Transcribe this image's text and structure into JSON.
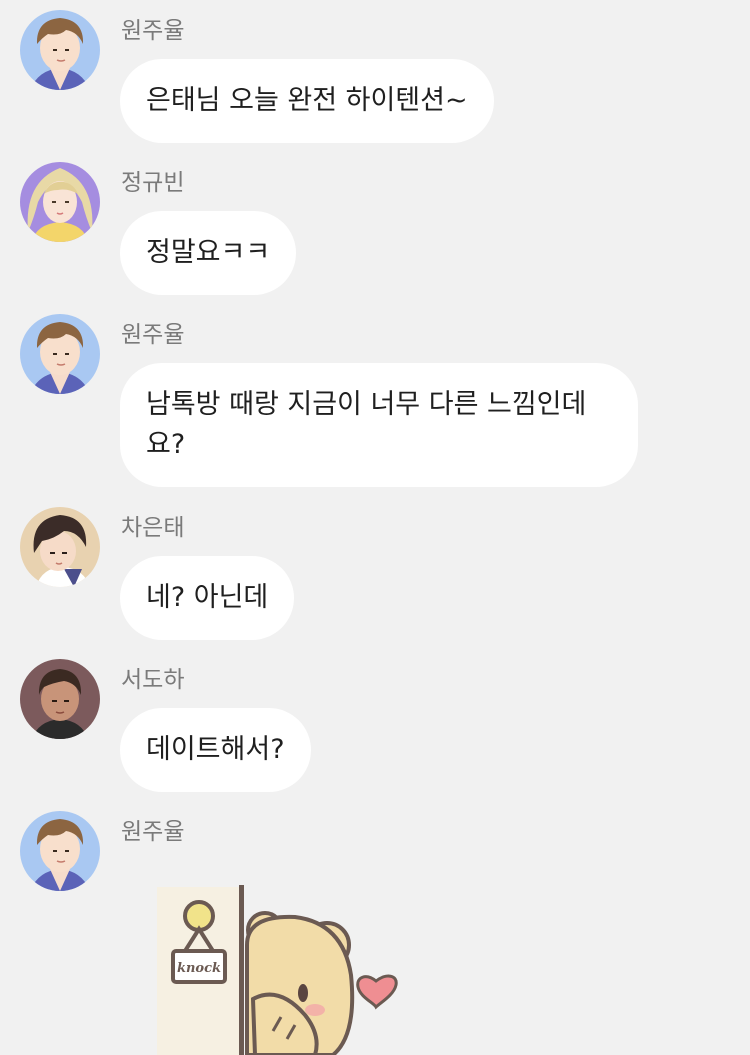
{
  "messages": [
    {
      "sender": "원주율",
      "avatar": "boy-brown-hair-avatar",
      "text": "은태님 오늘 완전 하이텐션~"
    },
    {
      "sender": "정규빈",
      "avatar": "girl-blonde-hair-avatar",
      "text": "정말요ㅋㅋ"
    },
    {
      "sender": "원주율",
      "avatar": "boy-brown-hair-avatar",
      "text": "남톡방 때랑 지금이 너무 다른 느낌인데요?"
    },
    {
      "sender": "차은태",
      "avatar": "boy-dark-hair-avatar",
      "text": "네? 아닌데"
    },
    {
      "sender": "서도하",
      "avatar": "man-dark-skin-avatar",
      "text": "데이트해서?"
    },
    {
      "sender": "원주율",
      "avatar": "boy-brown-hair-avatar",
      "sticker": "bear-knock-door-sticker",
      "sticker_sign": "knock"
    }
  ],
  "colors": {
    "background": "#f1f1f1",
    "bubble": "#ffffff",
    "name_text": "#7a7a7a",
    "message_text": "#1f1f1f",
    "heart": "#ef8e92"
  }
}
